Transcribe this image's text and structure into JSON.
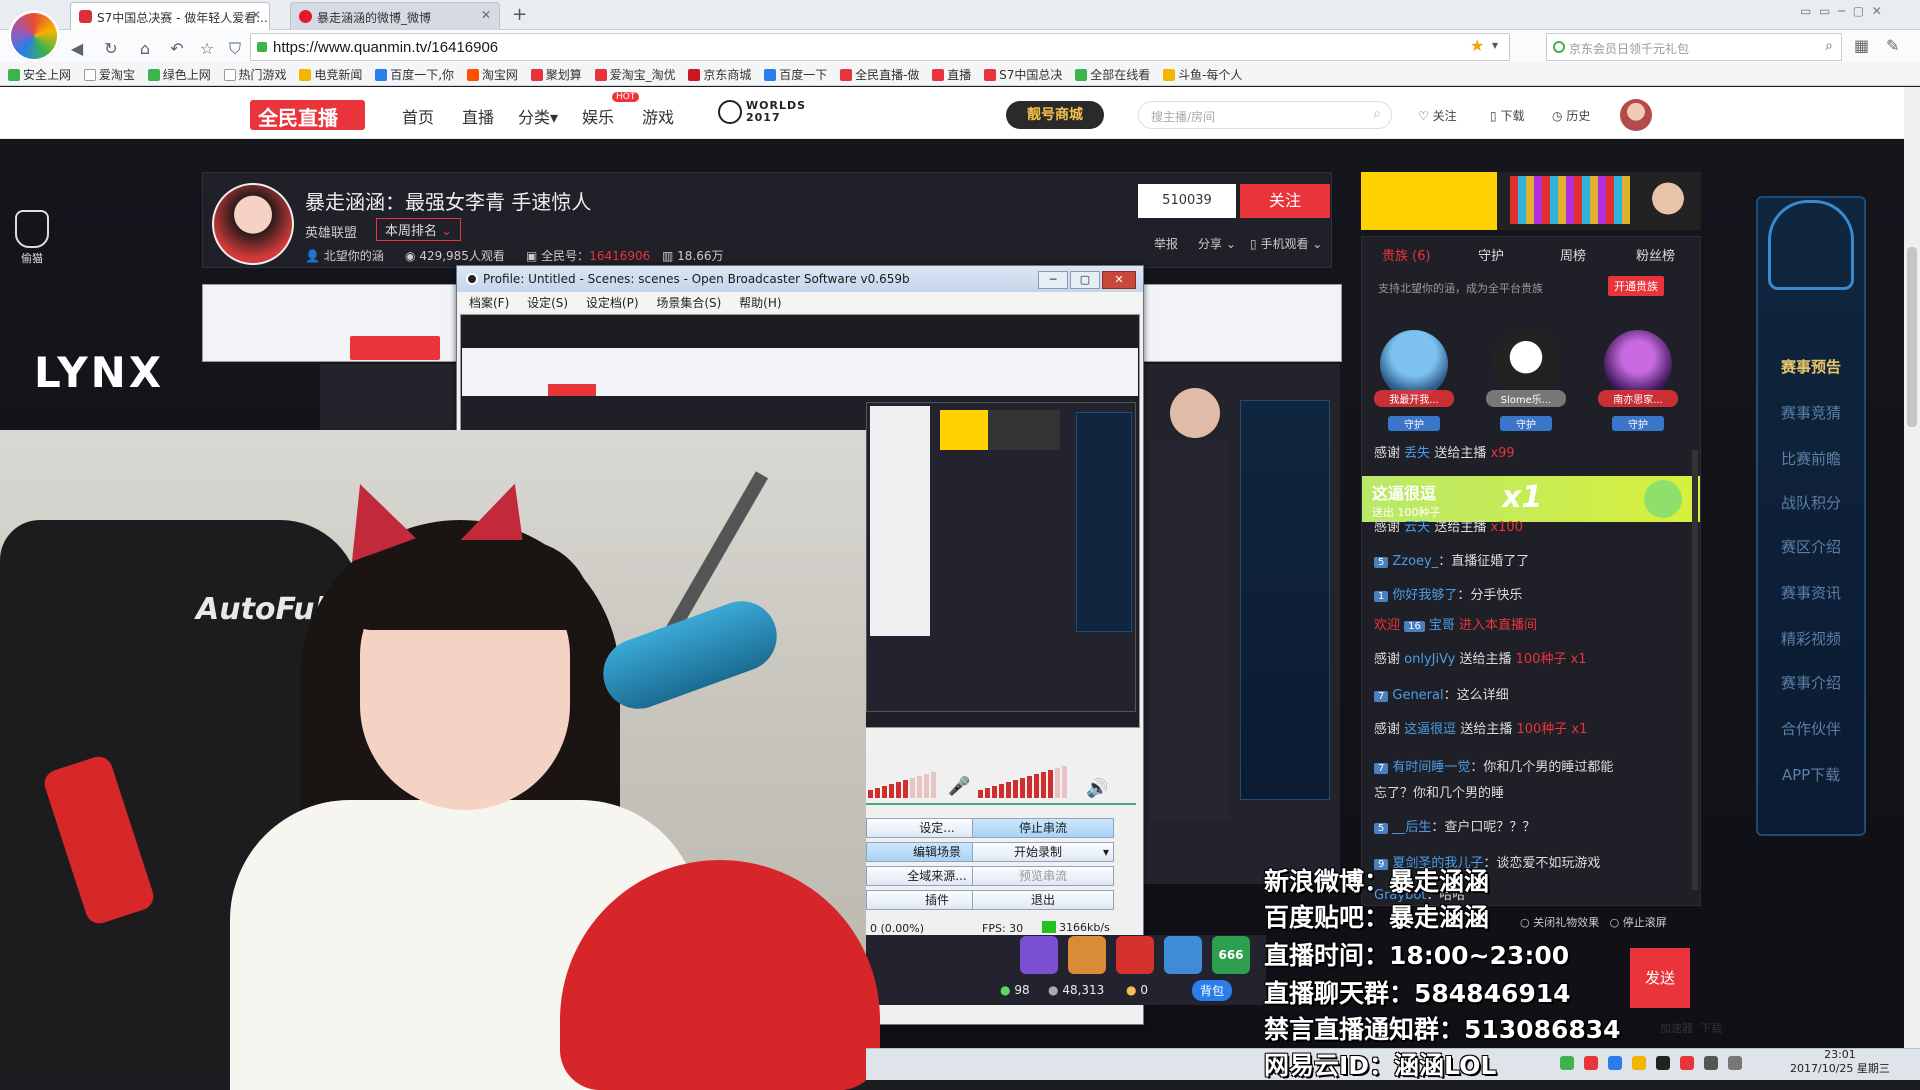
{
  "browser": {
    "tabs": [
      {
        "label": "S7中国总决赛 - 做年轻人爱看..."
      },
      {
        "label": "暴走涵涵的微博_微博"
      }
    ],
    "new_tab": "+",
    "url": "https://www.quanmin.tv/16416906",
    "search_placeholder": "京东会员日领千元礼包",
    "bookmarks": [
      "安全上网",
      "爱淘宝",
      "绿色上网",
      "热门游戏",
      "电竞新闻",
      "百度一下,你",
      "淘宝网",
      "聚划算",
      "爱淘宝_淘优",
      "京东商城",
      "百度一下",
      "全民直播-做",
      "直播",
      "S7中国总决",
      "全部在线看",
      "斗鱼-每个人"
    ]
  },
  "site": {
    "brand": "全民直播",
    "nav": [
      "首页",
      "直播",
      "分类▾",
      "娱乐",
      "游戏"
    ],
    "hot_badge": "HOT",
    "worlds_badge": [
      "WORLDS",
      "2017"
    ],
    "mall": "靓号商城",
    "search_placeholder": "搜主播/房间",
    "header_links": [
      "关注",
      "下载",
      "历史"
    ]
  },
  "room": {
    "title": "暴走涵涵：最强女李青 手速惊人",
    "category": "英雄联盟",
    "rank": "本周排名",
    "owner": "北望你的涵",
    "viewers": "429,985人观看",
    "room_label": "全民号：",
    "room_id": "16416906",
    "followers_label": "18.66万",
    "follow_count": "510039",
    "follow_button": "关注",
    "tools": [
      "举报",
      "分享",
      "手机观看"
    ]
  },
  "left_side": {
    "cat_label": "偷猫",
    "sponsor": "LYNX"
  },
  "right_panel": {
    "tabs": [
      "贵族 (6)",
      "守护",
      "周榜",
      "粉丝榜"
    ],
    "guard_hint": "支持北望你的涵，成为全平台贵族",
    "open_noble": "开通贵族",
    "guards": [
      {
        "name": "我最开我...",
        "badge": "守护"
      },
      {
        "name": "Slome乐...",
        "badge": "守护"
      },
      {
        "name": "南亦思家...",
        "badge": "守护"
      }
    ],
    "gift_banner": {
      "title": "这逼很逗",
      "sub": "送出 100种子",
      "count": "x1"
    },
    "chat": [
      {
        "pre": "感谢",
        "user": "丢失",
        "text": "送给主播",
        "tail": "x99"
      },
      {
        "pre": "感谢",
        "user": "云天",
        "text": "送给主播",
        "tail": "x100"
      },
      {
        "lv": "5",
        "user": "Zzoey_",
        "text": "：直播征婚了了"
      },
      {
        "lv": "1",
        "user": "你好我够了",
        "text": "：分手快乐"
      },
      {
        "pre": "欢迎",
        "lv": "16",
        "user": "宝哥",
        "text": "进入本直播间"
      },
      {
        "pre": "感谢",
        "user": "onlyJiVy",
        "text": "送给主播",
        "tail": "100种子  x1"
      },
      {
        "lv": "7",
        "user": "General",
        "text": "：这么详细"
      },
      {
        "pre": "感谢",
        "user": "这逼很逗",
        "text": "送给主播",
        "tail": "100种子  x1"
      },
      {
        "lv": "7",
        "user": "有时间睡一觉",
        "text": "：你和几个男的睡过都能"
      },
      {
        "cont": "忘了？你和几个男的睡"
      },
      {
        "lv": "5",
        "user": "__后生",
        "text": "：查户口呢？？？"
      },
      {
        "lv": "9",
        "user": "夏剑圣的我儿子",
        "text": "：谈恋爱不如玩游戏"
      },
      {
        "user": "Graybot",
        "text": "：哈哈"
      }
    ],
    "chat_options": [
      "关闭礼物效果",
      "停止滚屏"
    ],
    "send": "发送"
  },
  "right_sidebar": {
    "items": [
      "赛事预告",
      "赛事竞猜",
      "比赛前瞻",
      "战队积分",
      "赛区介绍",
      "赛事资讯",
      "精彩视频",
      "赛事介绍",
      "合作伙伴",
      "APP下载"
    ]
  },
  "obs": {
    "title": "Profile: Untitled - Scenes: scenes - Open Broadcaster Software v0.659b",
    "menu": [
      "档案(F)",
      "设定(S)",
      "设定档(P)",
      "场景集合(S)",
      "帮助(H)"
    ],
    "buttons": [
      {
        "label": "设定...",
        "style": "normal"
      },
      {
        "label": "停止串流",
        "style": "blue"
      },
      {
        "label": "编辑场景",
        "style": "blue"
      },
      {
        "label": "开始录制",
        "style": "normal"
      },
      {
        "label": "全域来源...",
        "style": "normal"
      },
      {
        "label": "预览串流",
        "style": "dim"
      },
      {
        "label": "插件",
        "style": "normal"
      },
      {
        "label": "退出",
        "style": "normal"
      }
    ],
    "status_dropped": "0 (0.00%)",
    "status_fps": "FPS: 30",
    "status_bitrate": "3166kb/s",
    "mic_level": 0.55,
    "desktop_level": 0.85
  },
  "overlay": [
    "新浪微博：暴走涵涵",
    "百度贴吧：暴走涵涵",
    "直播时间：18:00~23:00",
    "直播聊天群：584846914",
    "禁言直播通知群：513086834",
    "网易云ID：涵涵LOL"
  ],
  "gifts": {
    "seeds": "98",
    "coins": "48,313",
    "gold": "0",
    "backpack": "背包",
    "badge_666": "666"
  },
  "taskbar": {
    "time": "23:01",
    "date": "2017/10/25 星期三",
    "accel": "加速器",
    "download": "下载"
  }
}
